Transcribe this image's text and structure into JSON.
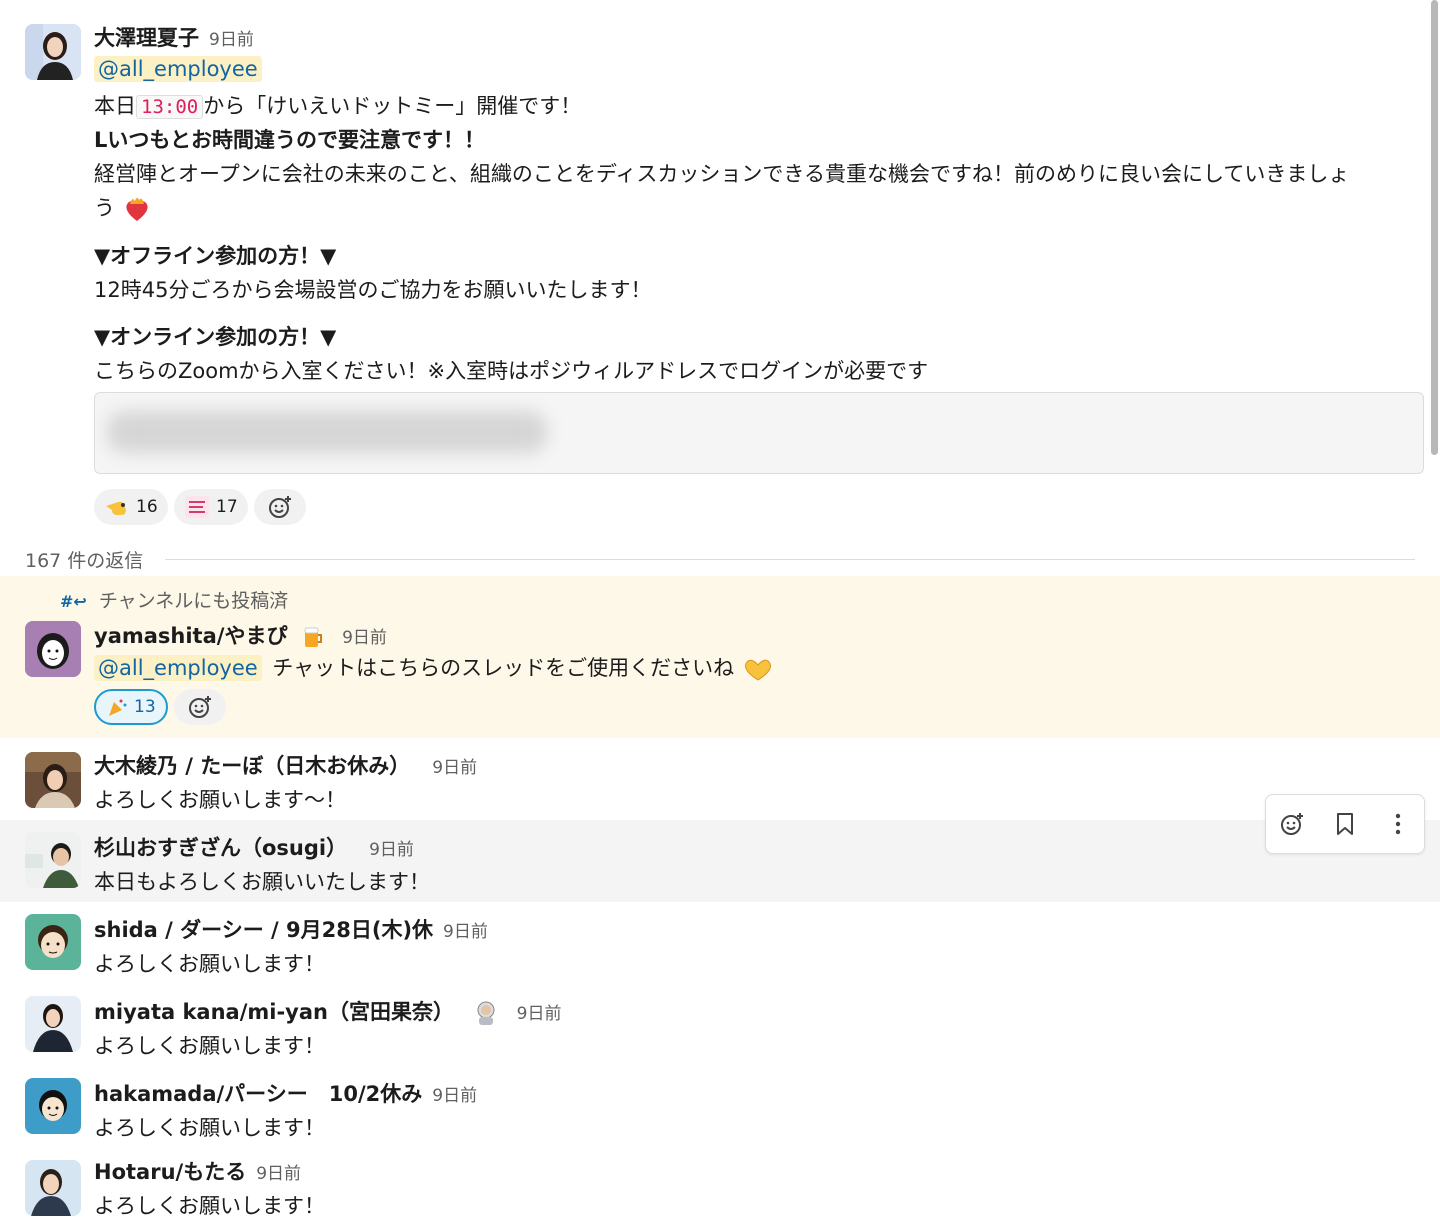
{
  "colors": {
    "mention_bg": "#fcf0c5",
    "mention_text": "#1264a3",
    "highlight_bg": "#fdf8e8",
    "hover_bg": "#f4f4f4",
    "code_text": "#e01e5a"
  },
  "parent": {
    "author": "大澤理夏子",
    "time": "9日前",
    "mention": "@all_employee",
    "line1_pre": "本日",
    "line1_code": "13:00",
    "line1_post": "から「けいえいドットミー」開催です！",
    "line2": "Lいつもとお時間違うので要注意です！！",
    "line3": "経営陣とオープンに会社の未来のこと、組織のことをディスカッションできる貴重な機会ですね！前のめりに良い会にしていきましょ",
    "line4": "う",
    "line4_emoji": "heart-on-fire-emoji",
    "offline_heading": "▼オフライン参加の方！▼",
    "offline_text": "12時45分ごろから会場設営のご協力をお願いいたします！",
    "online_heading": "▼オンライン参加の方！▼",
    "online_text": "こちらのZoomから入室ください！※入室時はポジウィルアドレスでログインが必要です",
    "reactions": [
      {
        "emoji": "pointing-hand-emoji",
        "count": "16"
      },
      {
        "emoji": "thanks-stamp-emoji",
        "count": "17"
      }
    ],
    "add_reaction_icon": "add-reaction-icon"
  },
  "reply_count": "167 件の返信",
  "broadcast": {
    "label": "チャンネルにも投稿済",
    "icon": "channel-broadcast-icon",
    "author": "yamashita/やまぴ",
    "status_emoji": "beer-emoji",
    "time": "9日前",
    "mention": "@all_employee",
    "text": "チャットはこちらのスレッドをご使用くださいね",
    "text_emoji": "heart-hands-emoji",
    "reactions": [
      {
        "emoji": "party-popper-emoji",
        "count": "13"
      }
    ]
  },
  "replies": [
    {
      "author": "大木綾乃 / たーぼ（日木お休み）",
      "time": "9日前",
      "text": "よろしくお願いします〜！"
    },
    {
      "author": "杉山おすぎざん（osugi）",
      "time": "9日前",
      "text": "本日もよろしくお願いいたします！"
    },
    {
      "author": "shida / ダーシー / 9月28日(木)休",
      "time": "9日前",
      "text": "よろしくお願いします！"
    },
    {
      "author": "miyata kana/mi-yan（宮田果奈）",
      "time": "9日前",
      "text": "よろしくお願いします！",
      "status_emoji": "astronaut-emoji"
    },
    {
      "author": "hakamada/パーシー　10/2休み",
      "time": "9日前",
      "text": "よろしくお願いします！"
    },
    {
      "author": "Hotaru/もたる",
      "time": "9日前",
      "text": "よろしくお願いします！"
    }
  ],
  "hover_toolbar": {
    "icons": [
      "add-reaction-icon",
      "bookmark-icon",
      "more-vertical-icon"
    ]
  }
}
